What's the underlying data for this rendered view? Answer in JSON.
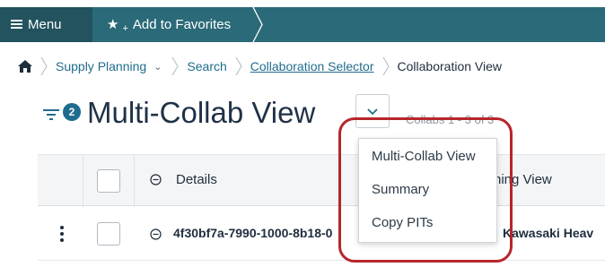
{
  "topbar": {
    "menu_label": "Menu",
    "favorites_label": "Add to Favorites",
    "favorites_plus": "+"
  },
  "breadcrumb": {
    "items": [
      "Supply Planning",
      "Search",
      "Collaboration Selector",
      "Collaboration View"
    ]
  },
  "page": {
    "filter_count": "2",
    "title": "Multi-Collab View",
    "collabs_count": "Collabs 1 - 3 of 3"
  },
  "table": {
    "details_header": "Details",
    "partial_header": "ning View",
    "rows": [
      {
        "id": "4f30bf7a-7990-1000-8b18-0",
        "vendor": "Kawasaki Heav"
      }
    ]
  },
  "dropdown": {
    "items": [
      "Multi-Collab View",
      "Summary",
      "Copy PITs"
    ]
  },
  "colors": {
    "topbar": "#2b6a78",
    "menu_button": "#22535e",
    "link": "#1f6c8e",
    "highlight": "#b6262b"
  }
}
